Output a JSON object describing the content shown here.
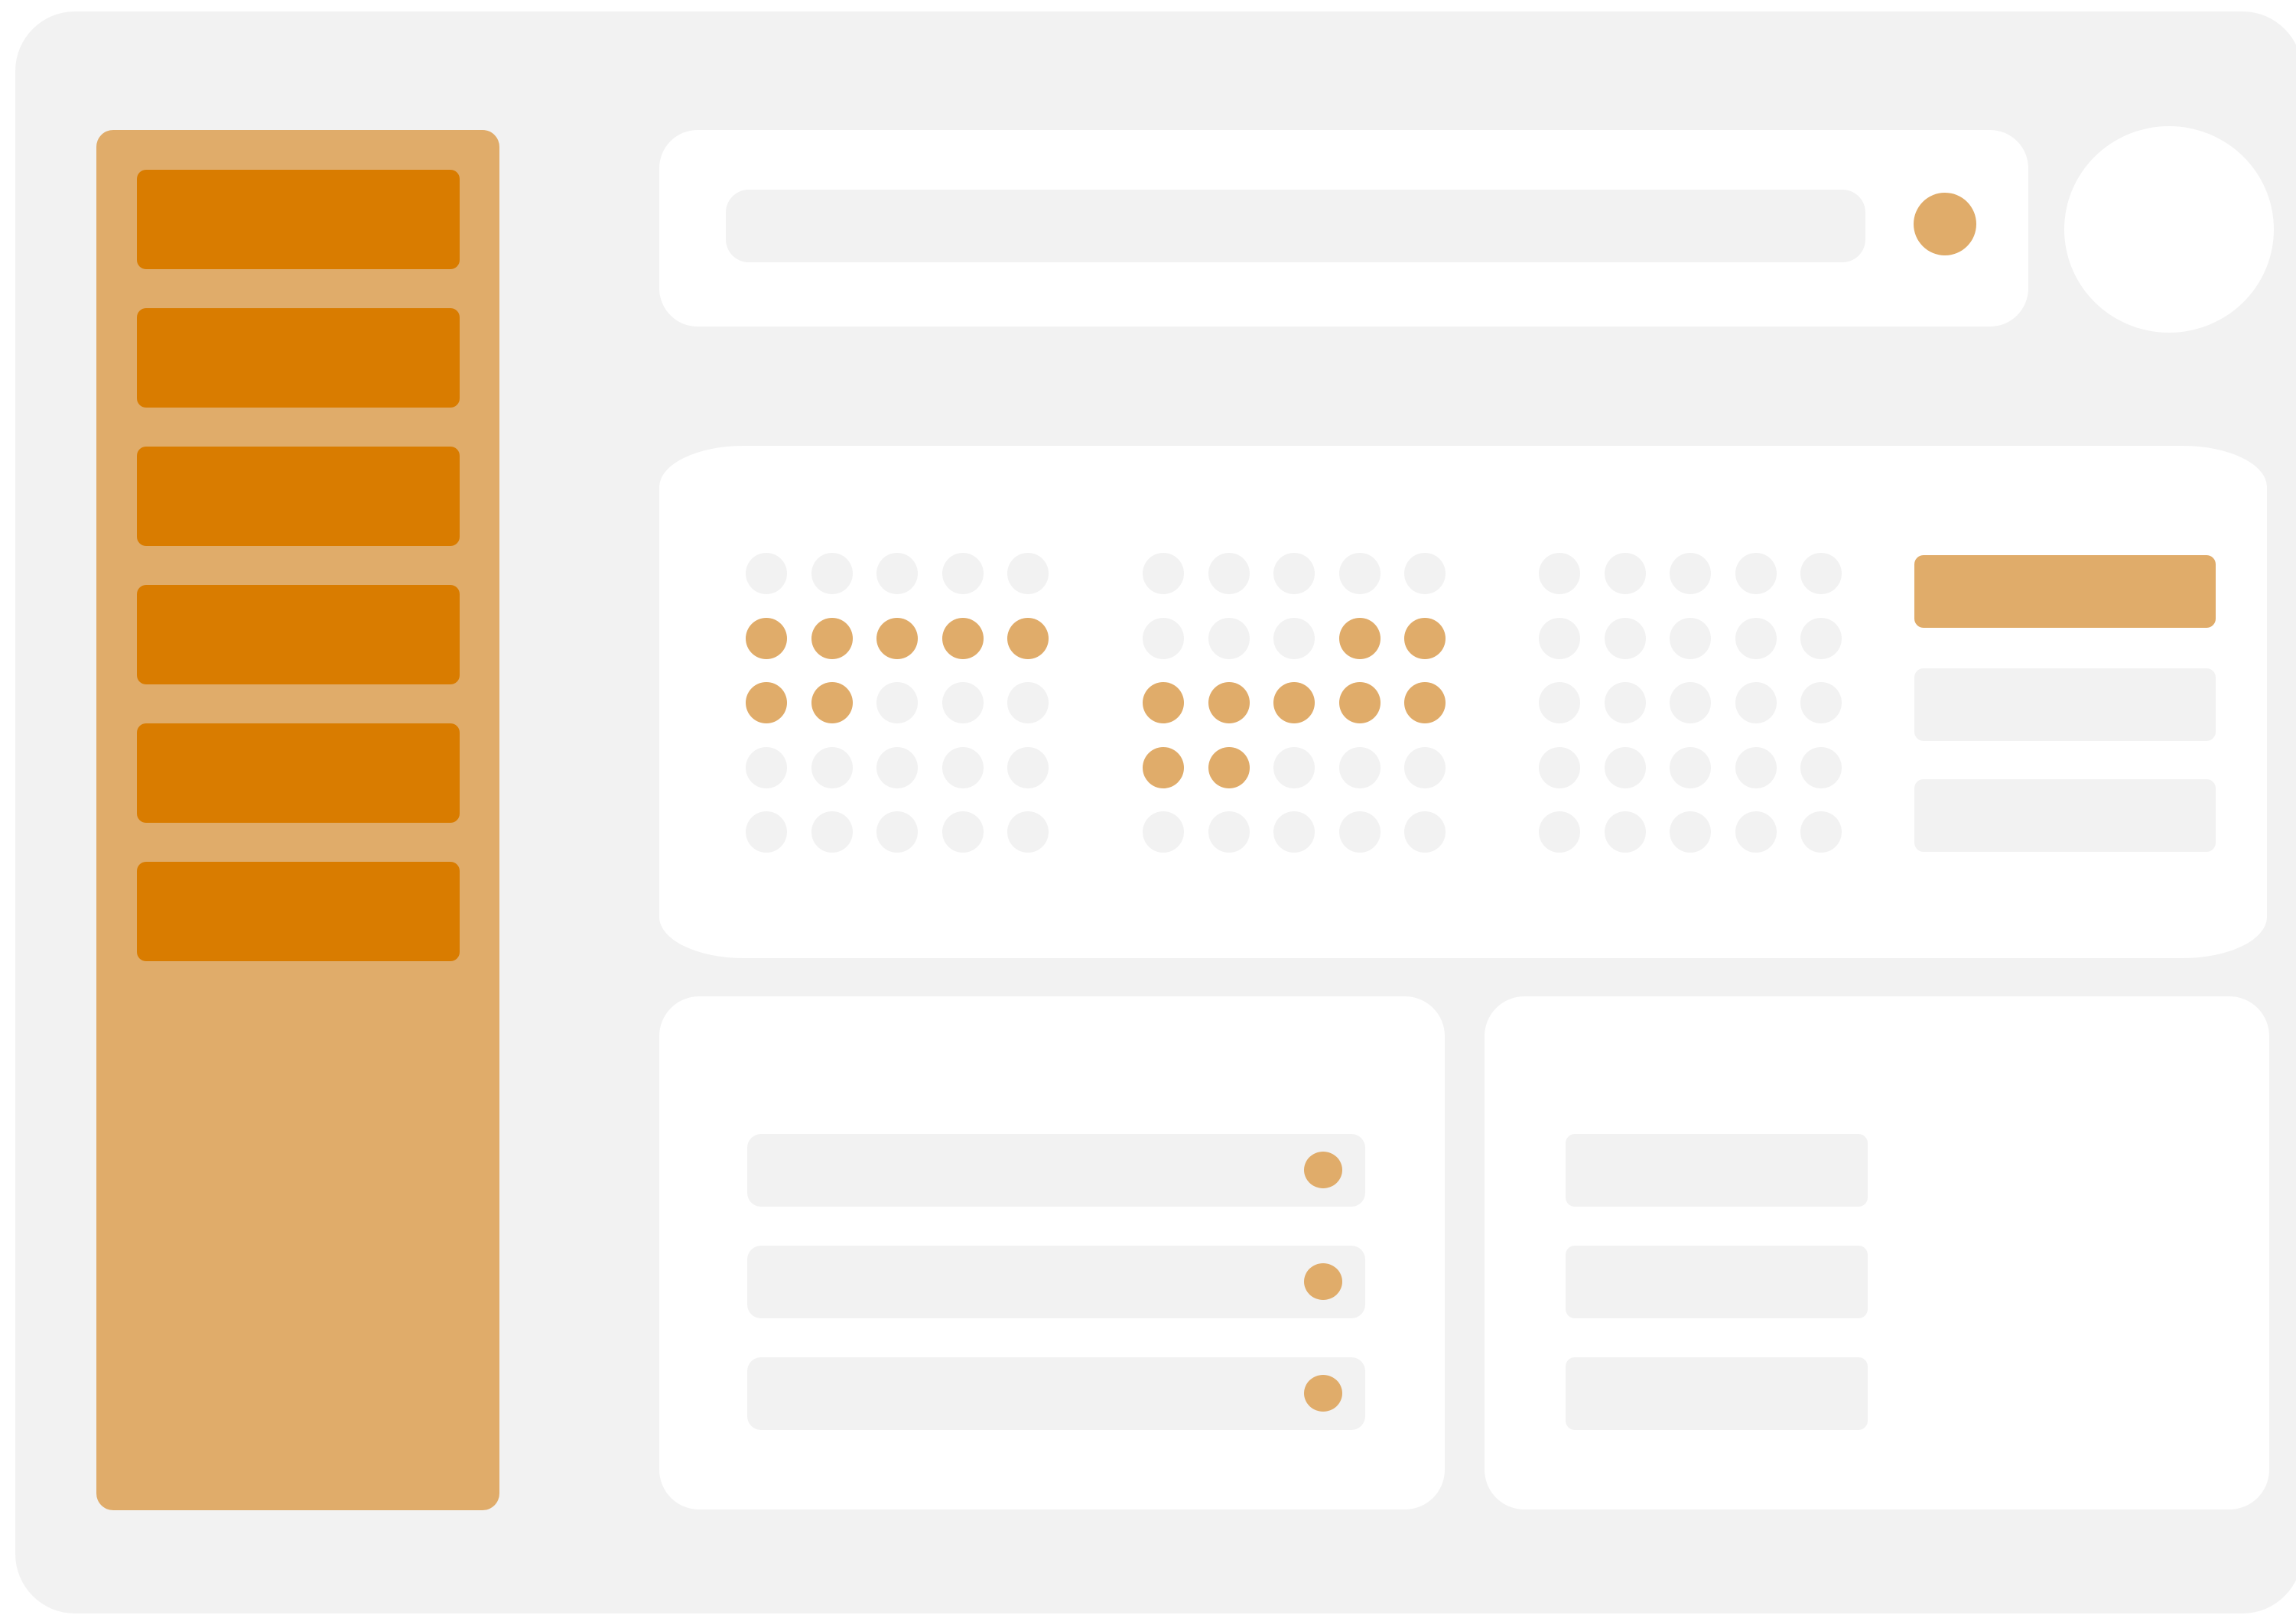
{
  "colors": {
    "window_bg": "#f2f2f2",
    "panel": "#ffffff",
    "accent_light": "#e0ac6a",
    "accent": "#d97c00",
    "muted": "#f2f2f2"
  },
  "sidebar": {
    "items": [
      {
        "label": "",
        "icon": "nav-item"
      },
      {
        "label": "",
        "icon": "nav-item"
      },
      {
        "label": "",
        "icon": "nav-item"
      },
      {
        "label": "",
        "icon": "nav-item"
      },
      {
        "label": "",
        "icon": "nav-item"
      },
      {
        "label": "",
        "icon": "nav-item"
      }
    ]
  },
  "search": {
    "value": "",
    "placeholder": "",
    "button_icon": "search-icon"
  },
  "header": {
    "avatar_icon": "avatar-icon"
  },
  "dot_matrix": {
    "groups": [
      [
        [
          0,
          0,
          0,
          0,
          0
        ],
        [
          1,
          1,
          1,
          1,
          1
        ],
        [
          1,
          1,
          0,
          0,
          0
        ],
        [
          0,
          0,
          0,
          0,
          0
        ],
        [
          0,
          0,
          0,
          0,
          0
        ]
      ],
      [
        [
          0,
          0,
          0,
          0,
          0
        ],
        [
          0,
          0,
          0,
          1,
          1
        ],
        [
          1,
          1,
          1,
          1,
          1
        ],
        [
          1,
          1,
          0,
          0,
          0
        ],
        [
          0,
          0,
          0,
          0,
          0
        ]
      ],
      [
        [
          0,
          0,
          0,
          0,
          0
        ],
        [
          0,
          0,
          0,
          0,
          0
        ],
        [
          0,
          0,
          0,
          0,
          0
        ],
        [
          0,
          0,
          0,
          0,
          0
        ],
        [
          0,
          0,
          0,
          0,
          0
        ]
      ]
    ],
    "options": [
      {
        "label": "",
        "selected": true
      },
      {
        "label": "",
        "selected": false
      },
      {
        "label": "",
        "selected": false
      }
    ]
  },
  "list_left": {
    "rows": [
      {
        "label": "",
        "toggle_icon": "toggle-dot-icon"
      },
      {
        "label": "",
        "toggle_icon": "toggle-dot-icon"
      },
      {
        "label": "",
        "toggle_icon": "toggle-dot-icon"
      }
    ]
  },
  "list_right": {
    "rows": [
      {
        "label": ""
      },
      {
        "label": ""
      },
      {
        "label": ""
      }
    ]
  }
}
